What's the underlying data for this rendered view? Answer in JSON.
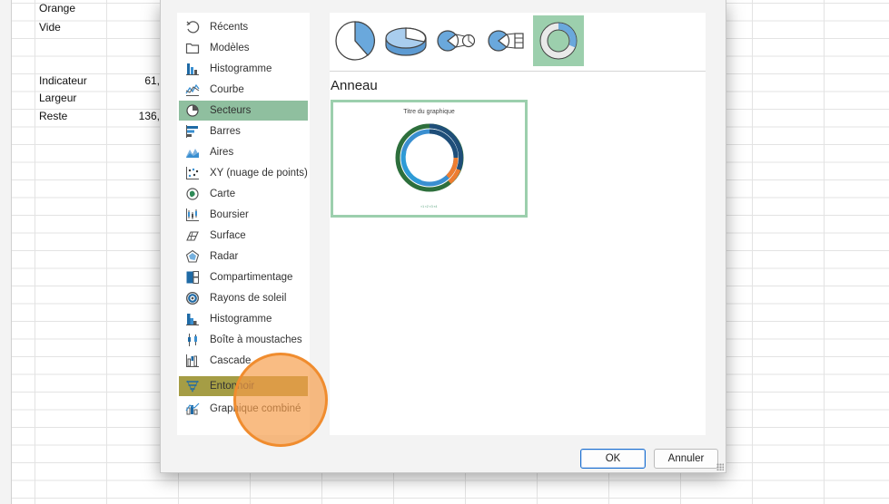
{
  "sheet": {
    "rows": [
      {
        "label": "Orange",
        "value": ""
      },
      {
        "label": "Vide",
        "value": ""
      },
      {
        "label": "Indicateur",
        "value": "61,"
      },
      {
        "label": "Largeur",
        "value": ""
      },
      {
        "label": "Reste",
        "value": "136,"
      }
    ]
  },
  "dialog": {
    "categories": [
      {
        "label": "Récents",
        "icon": "recent-icon"
      },
      {
        "label": "Modèles",
        "icon": "templates-icon"
      },
      {
        "label": "Histogramme",
        "icon": "column-chart-icon"
      },
      {
        "label": "Courbe",
        "icon": "line-chart-icon"
      },
      {
        "label": "Secteurs",
        "icon": "pie-chart-icon"
      },
      {
        "label": "Barres",
        "icon": "bar-chart-icon"
      },
      {
        "label": "Aires",
        "icon": "area-chart-icon"
      },
      {
        "label": "XY (nuage de points)",
        "icon": "scatter-chart-icon"
      },
      {
        "label": "Carte",
        "icon": "map-chart-icon"
      },
      {
        "label": "Boursier",
        "icon": "stock-chart-icon"
      },
      {
        "label": "Surface",
        "icon": "surface-chart-icon"
      },
      {
        "label": "Radar",
        "icon": "radar-chart-icon"
      },
      {
        "label": "Compartimentage",
        "icon": "treemap-chart-icon"
      },
      {
        "label": "Rayons de soleil",
        "icon": "sunburst-chart-icon"
      },
      {
        "label": "Histogramme",
        "icon": "histogram-chart-icon"
      },
      {
        "label": "Boîte à moustaches",
        "icon": "box-whisker-chart-icon"
      },
      {
        "label": "Cascade",
        "icon": "waterfall-chart-icon"
      },
      {
        "label": "Entonnoir",
        "icon": "funnel-chart-icon"
      },
      {
        "label": "Graphique combiné",
        "icon": "combo-chart-icon"
      }
    ],
    "selected_category": "Secteurs",
    "subtypes": [
      "pie",
      "3d-pie",
      "pie-of-pie",
      "bar-of-pie",
      "doughnut"
    ],
    "selected_subtype": "doughnut",
    "type_title": "Anneau",
    "preview_title": "Titre du graphique",
    "preview_legend": "▪1 ▪2 ▪3 ▪4",
    "ok_label": "OK",
    "cancel_label": "Annuler"
  },
  "colors": {
    "selection": "#8fbf9f",
    "accent": "#9ccfad",
    "cursor": "#f08c2e"
  }
}
